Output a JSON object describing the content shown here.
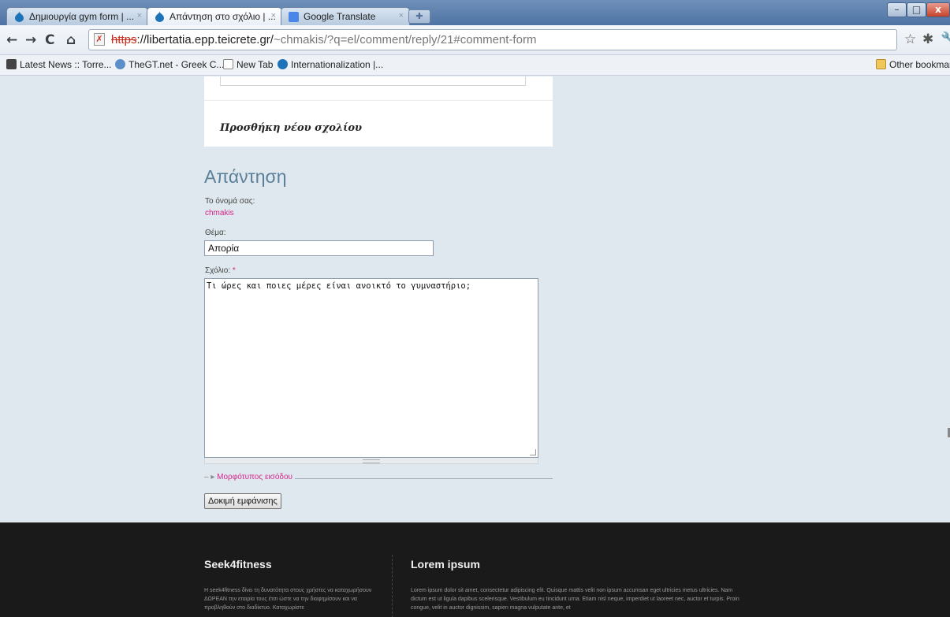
{
  "browser": {
    "tabs": [
      {
        "title": "Δημιουργία gym form | ..."
      },
      {
        "title": "Απάντηση στο σχόλιο | ..."
      },
      {
        "title": "Google Translate"
      }
    ],
    "url": {
      "scheme": "https",
      "host_part": "://libertatia.epp.teicrete.gr/",
      "path_part": "~chmakis/?q=el/comment/reply/21#comment-form"
    },
    "bookmarks": [
      {
        "label": "Latest News :: Torre..."
      },
      {
        "label": "TheGT.net - Greek C..."
      },
      {
        "label": "New Tab"
      },
      {
        "label": "Internationalization |..."
      }
    ],
    "other_bookmarks": "Other bookmark"
  },
  "page": {
    "add_new_comment": "Προσθήκη νέου σχολίου",
    "reply_title": "Απάντηση",
    "name_label": "Το όνομά σας:",
    "username": "chmakis",
    "subject_label": "Θέμα:",
    "subject_value": "Απορία",
    "comment_label": "Σχόλιο:",
    "required_mark": "*",
    "comment_value": "Τι ώρες και ποιες μέρες είναι ανοικτό το γυμναστήριο;",
    "input_format": "Μορφότυπος εισόδου",
    "preview_button": "Δοκιμή εμφάνισης"
  },
  "footer": {
    "left_title": "Seek4fitness",
    "left_text": "Η seek4fitness δίνει τη δυνατότητα στους χρήστες να καταχωρήσουν ΔΩΡΕΑΝ την εταιρία τους έτσι ώστε να την διαφημίσουν και να προβληθούν στο διαδίκτυο. Καταχωρίστε",
    "right_title": "Lorem ipsum",
    "right_text": "Lorem ipsum dolor sit amet, consectetur adipiscing elit. Quisque mattis velit non ipsum accumsan eget ultricies metus ultricies. Nam dictum est ut ligula dapibus scelerisque. Vestibulum eu tincidunt urna. Etiam nisl neque, imperdiet ut laoreet nec, auctor et turpis. Proin congue, velit in auctor dignissim, sapien magna vulputate ante, et"
  },
  "colors": {
    "accent_pink": "#d7268a",
    "title_blue": "#5c7f99",
    "footer_bg": "#1a1a1a"
  }
}
